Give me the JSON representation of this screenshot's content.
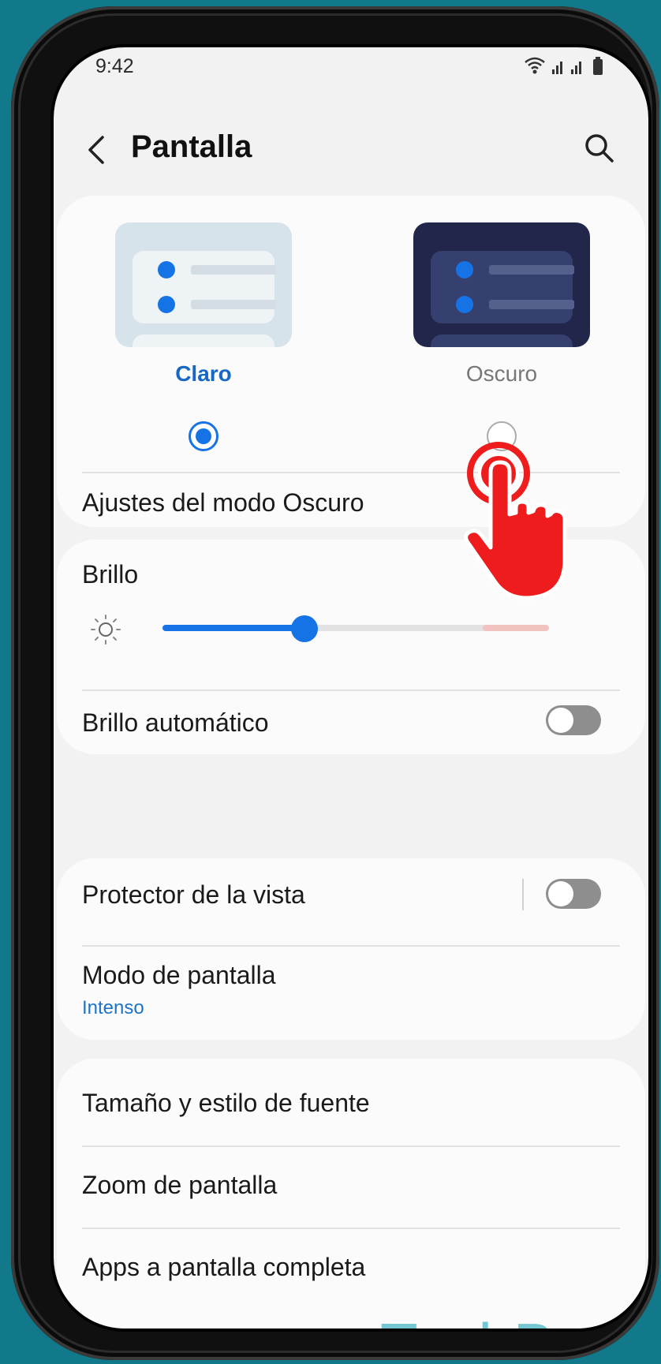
{
  "status_bar": {
    "time": "9:42"
  },
  "header": {
    "title": "Pantalla"
  },
  "theme": {
    "light_label": "Claro",
    "dark_label": "Oscuro",
    "selected": "Claro"
  },
  "dark_mode_settings": {
    "label": "Ajustes del modo Oscuro"
  },
  "brightness": {
    "label": "Brillo",
    "level_fraction": 0.36
  },
  "auto_brightness": {
    "label": "Brillo automático",
    "enabled": false
  },
  "eye_protector": {
    "label": "Protector de la vista",
    "enabled": false
  },
  "screen_mode": {
    "label": "Modo de pantalla",
    "value": "Intenso"
  },
  "menu_items": [
    {
      "label": "Tamaño y estilo de fuente"
    },
    {
      "label": "Zoom de pantalla"
    },
    {
      "label": "Apps a pantalla completa"
    }
  ],
  "watermark": "TechBone",
  "colors": {
    "accent": "#1573e6",
    "background": "#12798a",
    "tap_indicator": "#ee1c1c"
  }
}
